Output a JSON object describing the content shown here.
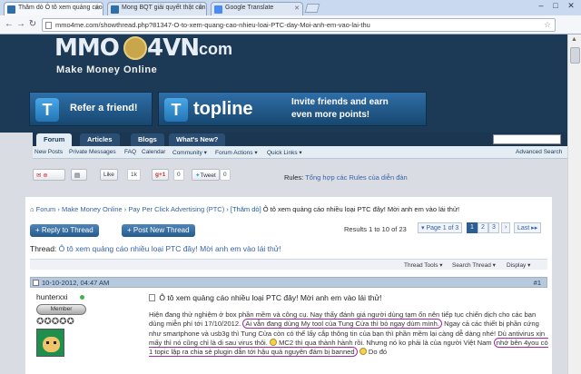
{
  "browser": {
    "tabs": [
      {
        "title": "Thăm dò Ô tô xem quảng cáo",
        "active": true,
        "icon_color": "#2f6ea8"
      },
      {
        "title": "Mong BQT giải quyết thật côn",
        "active": false,
        "icon_color": "#2f6ea8"
      },
      {
        "title": "Google Translate",
        "active": false,
        "icon_color": "#4a8af4"
      }
    ],
    "url": "mmo4me.com/showthread.php?81347-O-to-xem-quang-cao-nhieu-loai-PTC-day-Moi-anh-em-vao-lai-thu",
    "window_controls": [
      "–",
      "□",
      "✕"
    ]
  },
  "site": {
    "logo_part1": "MMO",
    "logo_part2": "4VN",
    "logo_suffix": ".com",
    "logo_tagline": "Make Money Online",
    "banner_refer": "Refer a friend!",
    "banner_topline_brand": "topline",
    "banner_topline_line1": "Invite friends and earn",
    "banner_topline_line2": "even more points!",
    "nav_tabs": [
      "Forum",
      "Articles",
      "Blogs",
      "What's New?"
    ],
    "subnav": [
      "New Posts",
      "Private Messages",
      "FAQ",
      "Calendar",
      "Community ▾",
      "Forum Actions ▾",
      "Quick Links ▾",
      "Advanced Search"
    ]
  },
  "share": {
    "like_label": "Like",
    "like_count": "1k",
    "gplus_label": "+1",
    "gplus_count": "0",
    "tweet_label": "Tweet",
    "tweet_count": "0",
    "rules_label": "Rules:",
    "rules_link": "Tổng hợp các Rules của diễn đàn"
  },
  "breadcrumb": {
    "items": [
      "Forum",
      "Make Money Online",
      "Pay Per Click Advertising (PTC)"
    ],
    "prefix": "[Thăm dò]",
    "current": "Ô tô xem quảng cáo nhiều loại PTC đây! Mời anh em vào lái thử!"
  },
  "thread": {
    "reply_button": "Reply to Thread",
    "new_post_button": "Post New Thread",
    "results": "Results 1 to 10 of 23",
    "pager": [
      "▾ Page 1 of 3",
      "1",
      "2",
      "3",
      "›",
      "Last ▸▸"
    ],
    "title_prefix": "Thread:",
    "title": "Ô tô xem quảng cáo nhiều loại PTC đây! Mời anh em vào lái thử!",
    "tools": [
      "Thread Tools ▾",
      "Search Thread ▾",
      "Display ▾"
    ]
  },
  "post": {
    "date": "10-10-2012, 04:47 AM",
    "number": "#1",
    "username": "hunterxxi",
    "badge": "Member",
    "reputation": "✪✪✪✪✪",
    "title": "Ô tô xem quảng cáo nhiều loại PTC đây! Mời anh em vào lái thử!",
    "text_1": "Hiện đang thử nghiệm ở box phần mềm và công cụ. Nay thấy đánh giá người dùng tạm ổn nên tiếp tục chiến dịch cho các bạn dùng miễn phí tới 17/10/2012.",
    "text_hl1": "Ai vẫn đang dùng My tool của Tung Cửa thì bỏ ngay dùm mình.",
    "text_2": "Ngay cả các thiết bị phần cứng như smartphone và usb3g thì Tung Cửa còn có thể lấy cắp thông tin của bạn thì phần mềm lại càng dễ dàng nhé! Dù antivirus xịn mấy thì nó cũng chỉ là di sau virus thôi.",
    "text_3": "MC2 thì qua thành hành rồi. Nhưng nó ko phải là của người Việt Nam",
    "text_hl2": "nhớ bên 4you có 1 topic lập ra chia sẻ plugin dẫn tới hậu quả nguyên đám bị banned",
    "text_4": "Do đó"
  }
}
